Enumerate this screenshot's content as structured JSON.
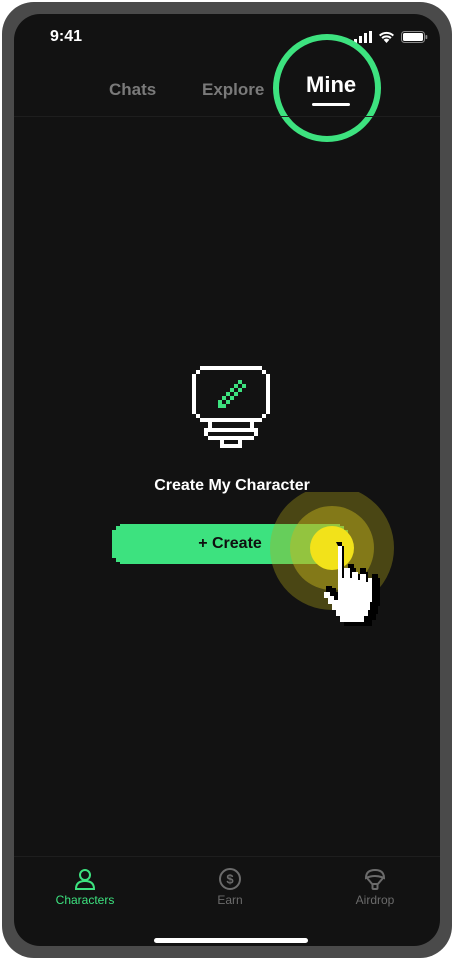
{
  "status_bar": {
    "time": "9:41"
  },
  "top_tabs": [
    {
      "label": "Chats",
      "active": false
    },
    {
      "label": "Explore",
      "active": false
    },
    {
      "label": "Mine",
      "active": true
    }
  ],
  "empty_state": {
    "icon": "pixel-monitor-pencil-icon",
    "title": "Create My Character",
    "create_button": "+ Create"
  },
  "bottom_nav": [
    {
      "label": "Characters",
      "icon": "user-icon",
      "active": true
    },
    {
      "label": "Earn",
      "icon": "dollar-coin-icon",
      "active": false
    },
    {
      "label": "Airdrop",
      "icon": "parachute-icon",
      "active": false
    }
  ],
  "colors": {
    "accent": "#3de27f",
    "background": "#121212",
    "inactive": "#6b6b6b",
    "tap_highlight": "#f2e21a"
  }
}
